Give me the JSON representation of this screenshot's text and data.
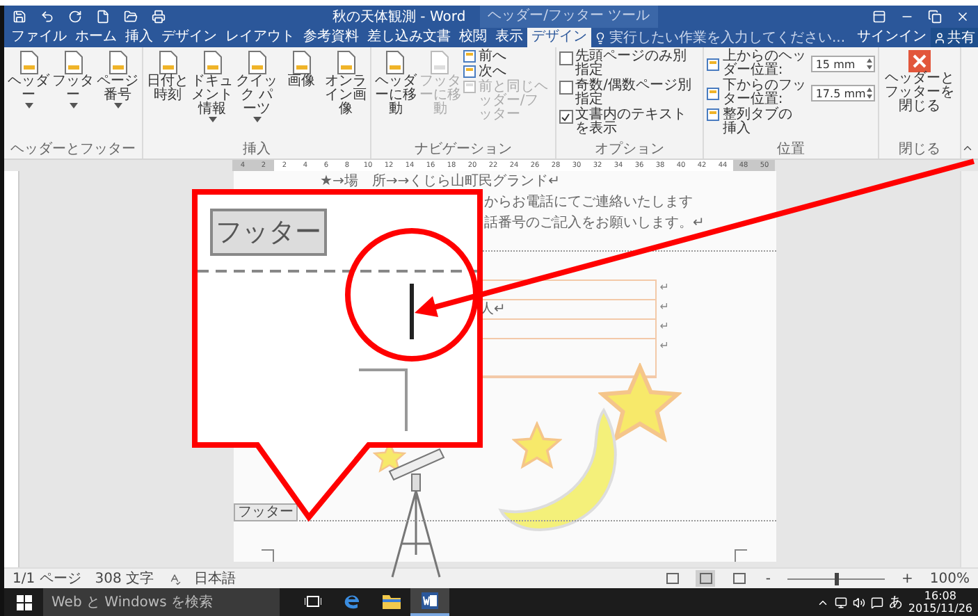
{
  "title_bar": {
    "title": "秋の天体観測 - Word",
    "context_title": "ヘッダー/フッター ツール"
  },
  "tabs": [
    {
      "label": "ファイル",
      "selected": false
    },
    {
      "label": "ホーム",
      "selected": false
    },
    {
      "label": "挿入",
      "selected": false
    },
    {
      "label": "デザイン",
      "selected": false
    },
    {
      "label": "レイアウト",
      "selected": false
    },
    {
      "label": "参考資料",
      "selected": false
    },
    {
      "label": "差し込み文書",
      "selected": false
    },
    {
      "label": "校閲",
      "selected": false
    },
    {
      "label": "表示",
      "selected": false
    },
    {
      "label": "デザイン",
      "selected": true
    }
  ],
  "tell_me": {
    "placeholder": "実行したい作業を入力してください..."
  },
  "account": {
    "sign_in": "サインイン",
    "share": "共有"
  },
  "ribbon": {
    "groups": [
      {
        "label": "ヘッダーとフッター",
        "items": [
          {
            "kind": "large",
            "label": "ヘッダー",
            "dropdown": true,
            "disabled": false
          },
          {
            "kind": "large",
            "label": "フッター",
            "dropdown": true,
            "disabled": false
          },
          {
            "kind": "large",
            "label": "ページ番号",
            "dropdown": true,
            "disabled": false
          }
        ]
      },
      {
        "label": "挿入",
        "items": [
          {
            "kind": "large",
            "label": "日付と時刻",
            "dropdown": false,
            "disabled": false
          },
          {
            "kind": "large",
            "label": "ドキュメント情報",
            "dropdown": true,
            "disabled": false
          },
          {
            "kind": "large",
            "label": "クイック パーツ",
            "dropdown": true,
            "disabled": false
          },
          {
            "kind": "large",
            "label": "画像",
            "dropdown": false,
            "disabled": false
          },
          {
            "kind": "large",
            "label": "オンライン画像",
            "dropdown": false,
            "disabled": false
          }
        ]
      },
      {
        "label": "ナビゲーション",
        "items": [
          {
            "kind": "large",
            "label": "ヘッダーに移動",
            "dropdown": false,
            "disabled": false
          },
          {
            "kind": "large",
            "label": "フッターに移動",
            "dropdown": false,
            "disabled": true
          },
          {
            "kind": "small",
            "label": "前へ",
            "disabled": false
          },
          {
            "kind": "small",
            "label": "次へ",
            "disabled": false
          },
          {
            "kind": "small",
            "label": "前と同じヘッダー/フッター",
            "disabled": true
          }
        ]
      },
      {
        "label": "オプション",
        "items": [
          {
            "kind": "check",
            "label": "先頭ページのみ別指定",
            "checked": false
          },
          {
            "kind": "check",
            "label": "奇数/偶数ページ別指定",
            "checked": false
          },
          {
            "kind": "check",
            "label": "文書内のテキストを表示",
            "checked": true
          }
        ]
      },
      {
        "label": "位置",
        "items": [
          {
            "kind": "spin",
            "label": "上からのヘッダー位置:",
            "value": "15 mm"
          },
          {
            "kind": "spin",
            "label": "下からのフッター位置:",
            "value": "17.5 mm"
          },
          {
            "kind": "small",
            "label": "整列タブの挿入",
            "disabled": false
          }
        ]
      },
      {
        "label": "閉じる",
        "items": [
          {
            "kind": "close",
            "label": "ヘッダーとフッターを閉じる"
          }
        ]
      }
    ]
  },
  "ruler": {
    "numbers": [
      "4",
      "2",
      "2",
      "4",
      "6",
      "8",
      "10",
      "12",
      "14",
      "16",
      "18",
      "20",
      "22",
      "24",
      "26",
      "28",
      "30",
      "32",
      "34",
      "36",
      "38",
      "40",
      "42",
      "44",
      "48",
      "50"
    ]
  },
  "document": {
    "lines": [
      {
        "text": "★→場　所→→くじら山町民グランド↵"
      },
      {
        "text": "からお電話にてご連絡いたします"
      },
      {
        "text": "話番号のご記入をお願いします。↵"
      }
    ],
    "table_rows": [
      {
        "end_mark": "↵"
      },
      {
        "cell": "人↵",
        "end_mark": "↵"
      },
      {
        "end_mark": "↵"
      },
      {
        "end_mark": "↵"
      }
    ],
    "footer_tag": "フッター"
  },
  "callout": {
    "label": "フッター"
  },
  "status_bar": {
    "page": "1/1 ページ",
    "words": "308 文字",
    "language": "日本語",
    "views": [
      {
        "selected": false
      },
      {
        "selected": true
      },
      {
        "selected": false
      }
    ],
    "zoom": {
      "minus": "-",
      "plus": "+",
      "level": 0.5,
      "reading": "100%"
    }
  },
  "taskbar": {
    "search_placeholder": "Web と Windows を検索",
    "apps": [
      {
        "kind": "task-view",
        "selected": false
      },
      {
        "kind": "browser",
        "selected": false
      },
      {
        "kind": "folder",
        "selected": false
      },
      {
        "kind": "word",
        "selected": true
      }
    ],
    "ime": "あ",
    "time": "16:08",
    "date": "2015/11/26"
  }
}
